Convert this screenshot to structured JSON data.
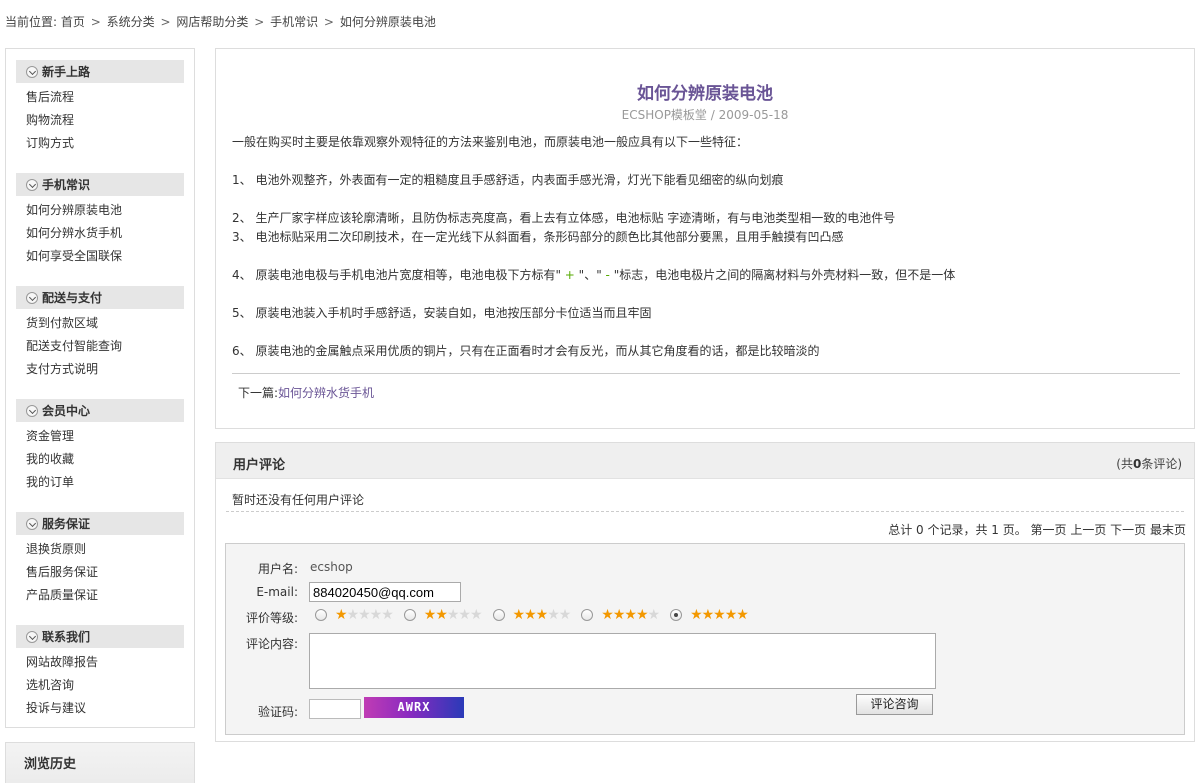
{
  "breadcrumb": {
    "prefix": "当前位置:",
    "items": [
      "首页",
      "系统分类",
      "网店帮助分类",
      "手机常识",
      "如何分辨原装电池"
    ]
  },
  "sidebar": {
    "categories": [
      {
        "title": "新手上路",
        "items": [
          "售后流程",
          "购物流程",
          "订购方式"
        ]
      },
      {
        "title": "手机常识",
        "items": [
          "如何分辨原装电池",
          "如何分辨水货手机",
          "如何享受全国联保"
        ]
      },
      {
        "title": "配送与支付",
        "items": [
          "货到付款区域",
          "配送支付智能查询",
          "支付方式说明"
        ]
      },
      {
        "title": "会员中心",
        "items": [
          "资金管理",
          "我的收藏",
          "我的订单"
        ]
      },
      {
        "title": "服务保证",
        "items": [
          "退换货原则",
          "售后服务保证",
          "产品质量保证"
        ]
      },
      {
        "title": "联系我们",
        "items": [
          "网站故障报告",
          "选机咨询",
          "投诉与建议"
        ]
      }
    ],
    "history_title": "浏览历史"
  },
  "article": {
    "title": "如何分辨原装电池",
    "meta": "ECSHOP模板堂 / 2009-05-18",
    "intro": "一般在购买时主要是依靠观察外观特征的方法来鉴别电池，而原装电池一般应具有以下一些特征：",
    "p1": "1、 电池外观整齐，外表面有一定的粗糙度且手感舒适，内表面手感光滑，灯光下能看见细密的纵向划痕",
    "p2": "2、 生产厂家字样应该轮廓清晰，且防伪标志亮度高，看上去有立体感，电池标贴 字迹清晰，有与电池类型相一致的电池件号",
    "p3": "3、 电池标贴采用二次印刷技术，在一定光线下从斜面看，条形码部分的颜色比其他部分要黑，且用手触摸有凹凸感",
    "p4_a": "4、 原装电池电极与手机电池片宽度相等，电池电极下方标有\"",
    "p4_plus": " + ",
    "p4_b": "\"、\"",
    "p4_minus": " - ",
    "p4_c": "\"标志，电池电极片之间的隔离材料与外壳材料一致，但不是一体",
    "p5": "5、 原装电池装入手机时手感舒适，安装自如，电池按压部分卡位适当而且牢固",
    "p6": "6、 原装电池的金属触点采用优质的铜片，只有在正面看时才会有反光，而从其它角度看的话，都是比较暗淡的",
    "next_label": "下一篇:",
    "next_link": "如何分辨水货手机"
  },
  "comments": {
    "title": "用户评论",
    "count_prefix": "(共",
    "count": "0",
    "count_suffix": "条评论)",
    "empty_text": "暂时还没有任何用户评论",
    "pager": "总计 0 个记录，共 1 页。 第一页 上一页 下一页 最末页",
    "form": {
      "username_label": "用户名:",
      "username_value": "ecshop",
      "email_label": "E-mail:",
      "email_value": "884020450@qq.com",
      "rating_label": "评价等级:",
      "rating_selected": 5,
      "content_label": "评论内容:",
      "content_value": "",
      "captcha_label": "验证码:",
      "captcha_text": "AWRX",
      "submit_label": "评论咨询"
    }
  }
}
